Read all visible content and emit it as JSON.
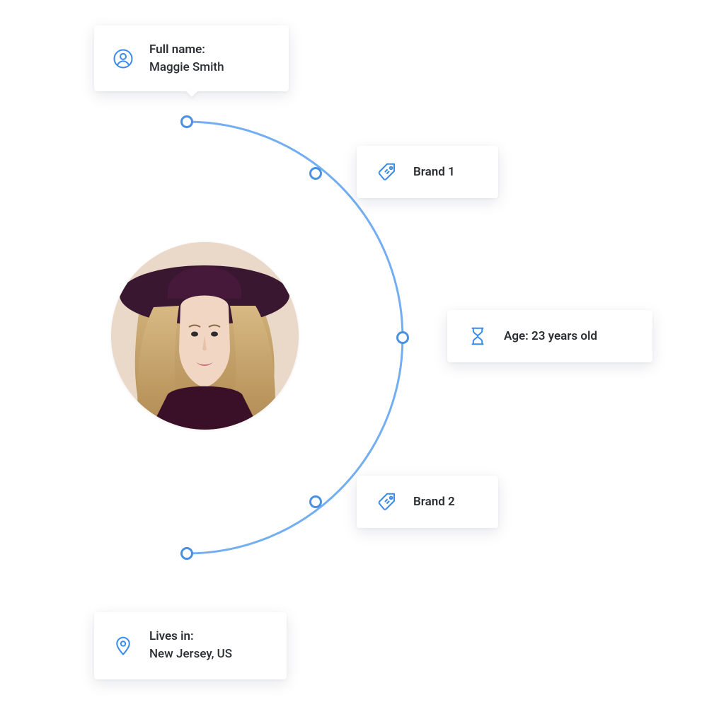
{
  "colors": {
    "accent": "#3a8bea",
    "arc": "#73aef2"
  },
  "profile": {
    "name_label": "Full name:",
    "name_value": "Maggie Smith",
    "age_text": "Age: 23 years old",
    "location_label": "Lives in:",
    "location_value": "New Jersey, US"
  },
  "brands": {
    "brand1": "Brand 1",
    "brand2": "Brand 2"
  },
  "icons": {
    "person": "person-icon",
    "tag": "tag-icon",
    "hourglass": "hourglass-icon",
    "pin": "location-pin-icon"
  }
}
